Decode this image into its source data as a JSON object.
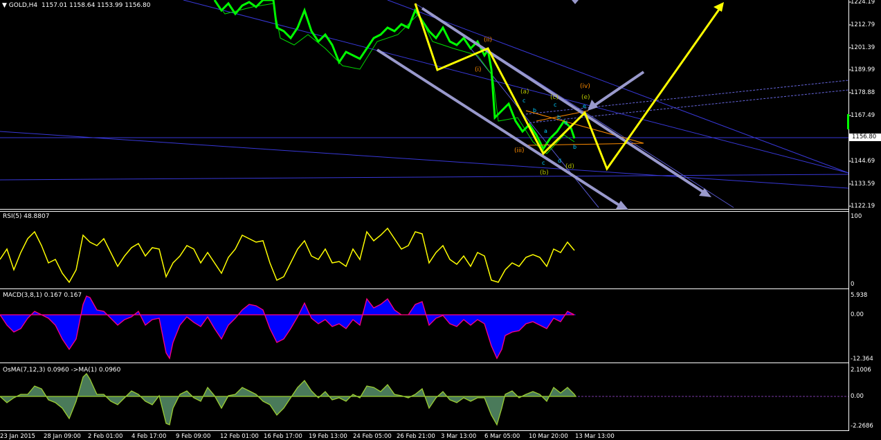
{
  "main_pane": {
    "title": "GOLD,H4",
    "ohlc": "1157.01 1158.64 1153.99 1156.80",
    "current_price": "1156.80",
    "price_ticks": [
      "1224.19",
      "1212.79",
      "1201.39",
      "1189.99",
      "1178.88",
      "1167.49",
      "1144.69",
      "1133.59",
      "1122.19"
    ]
  },
  "rsi_pane": {
    "title": "RSI(5) 48.8807",
    "ticks": [
      "100",
      "0"
    ]
  },
  "macd_pane": {
    "title": "MACD(3,8,1) 0.167 0.167",
    "ticks": [
      "5.938",
      "0.00",
      "-12.364"
    ]
  },
  "osma_pane": {
    "title": "OsMA(7,12,3) 0.0960  ->MA(1) 0.0960",
    "ticks": [
      "2.1006",
      "0.00",
      "-2.2686"
    ]
  },
  "time_axis": [
    "23 Jan 2015",
    "28 Jan 09:00",
    "2 Feb 01:00",
    "4 Feb 17:00",
    "9 Feb 09:00",
    "12 Feb 01:00",
    "16 Feb 17:00",
    "19 Feb 13:00",
    "24 Feb 05:00",
    "26 Feb 21:00",
    "3 Mar 13:00",
    "6 Mar 05:00",
    "10 Mar 20:00",
    "13 Mar 13:00"
  ],
  "wave_labels": {
    "ii": "(ii)",
    "i": "(i)",
    "iii": "(iii)",
    "iv": "(iv)",
    "a": "(a)",
    "b": "(b)",
    "c": "(c)",
    "d": "(d)",
    "e": "(e)",
    "sc1": "c",
    "sb1": "b",
    "sa1": "a",
    "sb2": "b",
    "sc2": "c",
    "sd1": "d",
    "se1": "e",
    "sb3": "b",
    "sc3": "c",
    "sd2": "d"
  },
  "colors": {
    "background": "#000000",
    "candles": "#00ff00",
    "trendlines": "#4040ff",
    "arrows": "#9999cc",
    "elliott": "#ffff00",
    "rsi": "#ffff00",
    "macd_hist": "#0000ff",
    "macd_signal": "#ff0080",
    "osma_line": "#9acd32",
    "wave_orange": "#ff8c00",
    "wave_olive": "#b5c400",
    "wave_cyan": "#00ccff"
  }
}
